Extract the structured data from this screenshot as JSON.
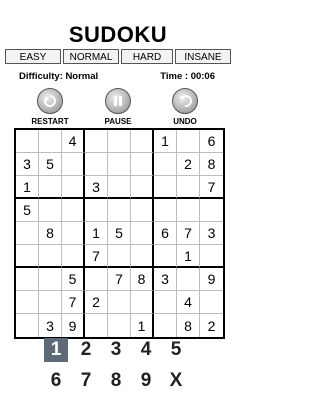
{
  "header": {
    "title": "SUDOKU"
  },
  "levels": [
    "EASY",
    "NORMAL",
    "HARD",
    "INSANE"
  ],
  "status": {
    "difficulty": "Difficulty: Normal",
    "time": "Time : 00:06"
  },
  "controls": {
    "restart": "RESTART",
    "pause": "PAUSE",
    "undo": "UNDO"
  },
  "board": [
    [
      "",
      "",
      "4",
      "",
      "",
      "",
      "1",
      "",
      "6"
    ],
    [
      "3",
      "5",
      "",
      "",
      "",
      "",
      "",
      "2",
      "8"
    ],
    [
      "1",
      "",
      "",
      "3",
      "",
      "",
      "",
      "",
      "7"
    ],
    [
      "5",
      "",
      "",
      "",
      "",
      "",
      "",
      "",
      ""
    ],
    [
      "",
      "8",
      "",
      "1",
      "5",
      "",
      "6",
      "7",
      "3"
    ],
    [
      "",
      "",
      "",
      "7",
      "",
      "",
      "",
      "1",
      ""
    ],
    [
      "",
      "",
      "5",
      "",
      "7",
      "8",
      "3",
      "",
      "9"
    ],
    [
      "",
      "",
      "7",
      "2",
      "",
      "",
      "",
      "4",
      ""
    ],
    [
      "",
      "3",
      "9",
      "",
      "",
      "1",
      "",
      "8",
      "2"
    ]
  ],
  "keypad": [
    "1",
    "2",
    "3",
    "4",
    "5",
    "6",
    "7",
    "8",
    "9",
    "X"
  ],
  "selected_key": "1",
  "colors": {
    "key_active_bg": "#5e6a78",
    "button_bg": "#f3f3f3"
  }
}
